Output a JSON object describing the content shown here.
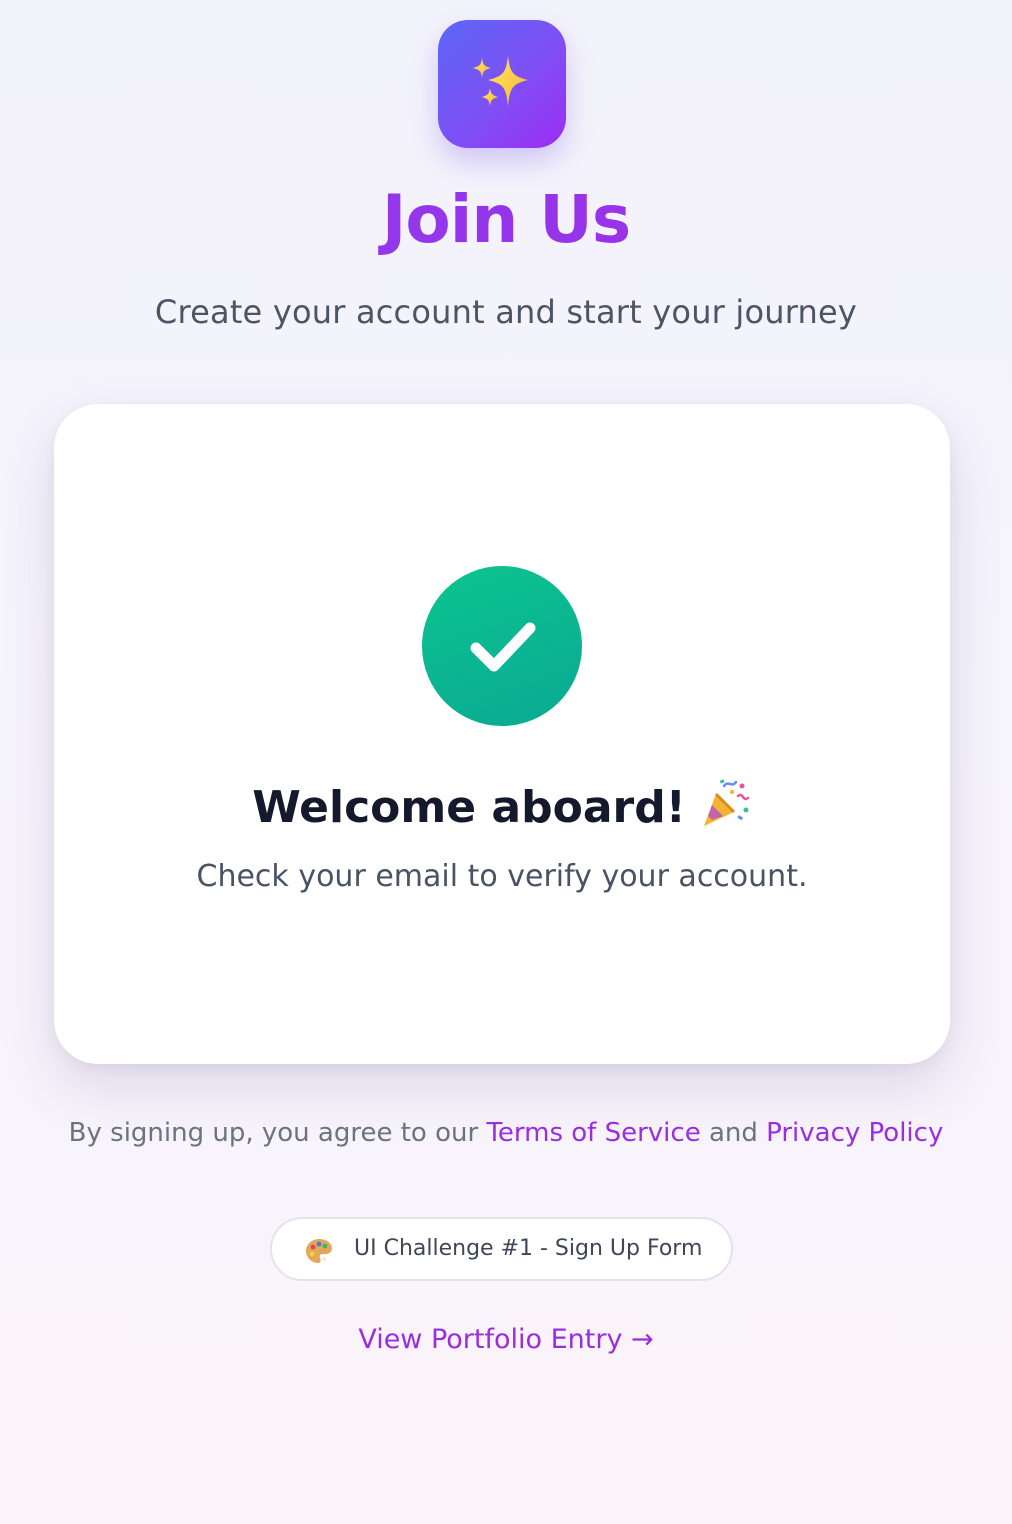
{
  "logo": {
    "icon": "sparkles-icon"
  },
  "header": {
    "title": "Join Us",
    "subtitle": "Create your account and start your journey"
  },
  "success_card": {
    "status_icon": "check-icon",
    "heading": "Welcome aboard!",
    "heading_emoji": "party-popper-icon",
    "message": "Check your email to verify your account."
  },
  "terms": {
    "prefix": "By signing up, you agree to our ",
    "terms_link": "Terms of Service",
    "joiner": " and ",
    "privacy_link": "Privacy Policy"
  },
  "badge": {
    "icon": "palette-icon",
    "label": "UI Challenge #1 - Sign Up Form"
  },
  "portfolio": {
    "link_label": "View Portfolio Entry →"
  },
  "colors": {
    "accent": "#9a2de0",
    "success": "#0cb88f",
    "logo_gradient_start": "#5b67f6",
    "logo_gradient_end": "#9b2df3"
  }
}
